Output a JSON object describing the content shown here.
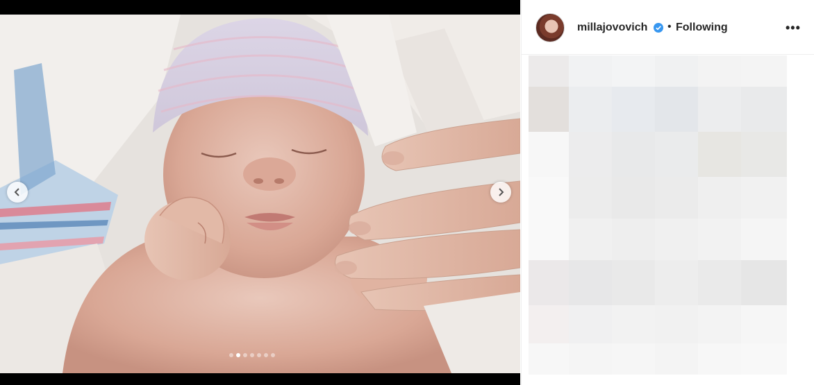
{
  "post": {
    "username": "millajovovich",
    "verified": true,
    "follow_status": "Following",
    "more_label": "•••"
  },
  "carousel": {
    "slide_count": 7,
    "active_index": 1
  },
  "icons": {
    "prev": "chevron-left-icon",
    "next": "chevron-right-icon",
    "verified": "verified-badge-icon",
    "more": "more-options-icon"
  },
  "colors": {
    "verified_blue": "#3897f0",
    "text": "#262626",
    "media_bg": "#000000"
  }
}
